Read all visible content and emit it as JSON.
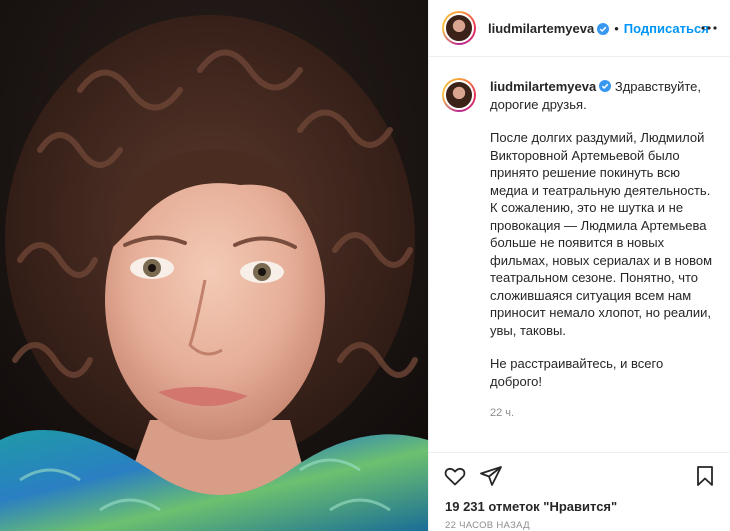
{
  "post": {
    "image_alt": "portrait photo",
    "author": "liudmilartemyeva",
    "follow_label": "Подписаться",
    "dot": "•"
  },
  "caption": {
    "greeting": "Здравствуйте, дорогие друзья.",
    "paragraph": "После долгих раздумий, Людмилой Викторовной Артемьевой было принято решение покинуть всю медиа и театральную деятельность. К сожалению, это не шутка и не провокация — Людмила Артемьева больше не появится в новых фильмах, новых сериалах и в новом театральном сезоне. Понятно, что сложившаяся ситуация всем нам приносит немало хлопот, но реалии, увы, таковы.",
    "closing": "Не расстраивайтесь, и всего доброго!",
    "time": "22 ч."
  },
  "footer": {
    "likes_text": "19 231 отметок \"Нравится\"",
    "posted_ago": "22 ЧАСОВ НАЗАД"
  },
  "icons": {
    "verified": "verified-badge-icon",
    "more": "more-options-icon",
    "like": "heart-icon",
    "share": "paper-plane-icon",
    "save": "bookmark-icon"
  },
  "colors": {
    "link_blue": "#0095f6",
    "muted": "#8e8e8e",
    "text": "#262626",
    "border": "#efefef"
  }
}
